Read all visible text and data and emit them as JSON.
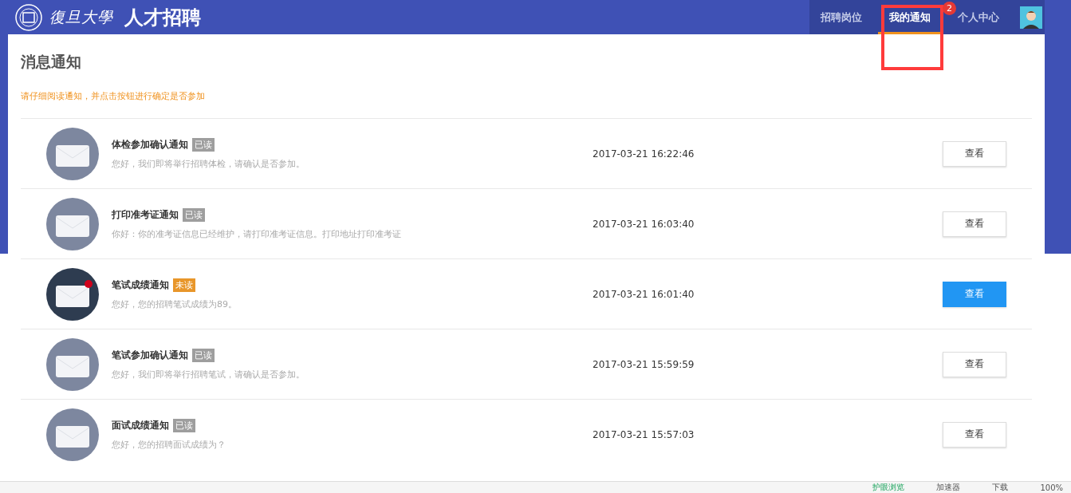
{
  "header": {
    "university": "復旦大學",
    "title": "人才招聘",
    "nav": [
      {
        "label": "招聘岗位",
        "selected": false
      },
      {
        "label": "我的通知",
        "selected": true,
        "badge": "2"
      },
      {
        "label": "个人中心",
        "selected": false
      }
    ]
  },
  "page": {
    "heading": "消息通知",
    "hint": "请仔细阅读通知，并点击按钮进行确定是否参加"
  },
  "notices": [
    {
      "title": "体检参加确认通知",
      "status": "已读",
      "read": true,
      "preview": "您好，我们即将举行招聘体检，请确认是否参加。",
      "time": "2017-03-21 16:22:46",
      "action": "查看"
    },
    {
      "title": "打印准考证通知",
      "status": "已读",
      "read": true,
      "preview": "你好：你的准考证信息已经维护，请打印准考证信息。打印地址打印准考证",
      "time": "2017-03-21 16:03:40",
      "action": "查看"
    },
    {
      "title": "笔试成绩通知",
      "status": "未读",
      "read": false,
      "preview": "您好，您的招聘笔试成绩为89。",
      "time": "2017-03-21 16:01:40",
      "action": "查看"
    },
    {
      "title": "笔试参加确认通知",
      "status": "已读",
      "read": true,
      "preview": "您好，我们即将举行招聘笔试，请确认是否参加。",
      "time": "2017-03-21 15:59:59",
      "action": "查看"
    },
    {
      "title": "面试成绩通知",
      "status": "已读",
      "read": true,
      "preview": "您好，您的招聘面试成绩为？",
      "time": "2017-03-21 15:57:03",
      "action": "查看"
    }
  ],
  "status_bar": [
    "护眼浏览",
    "加速器",
    "下载",
    "100%"
  ]
}
